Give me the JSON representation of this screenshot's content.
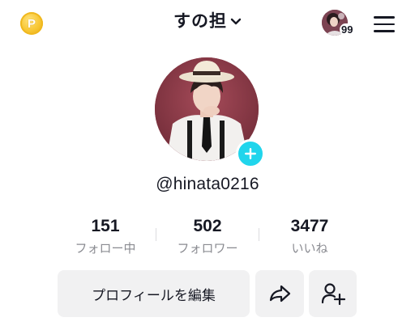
{
  "header": {
    "coin_symbol": "P",
    "title": "すの担",
    "notification_count": "99"
  },
  "profile": {
    "username": "@hinata0216"
  },
  "stats": [
    {
      "value": "151",
      "label": "フォロー中"
    },
    {
      "value": "502",
      "label": "フォロワー"
    },
    {
      "value": "3477",
      "label": "いいね"
    }
  ],
  "actions": {
    "edit_profile_label": "プロフィールを編集"
  },
  "colors": {
    "accent_add": "#20d5ec",
    "coin": "#f7c531",
    "button_bg": "#f1f1f2",
    "secondary_text": "#8a8b91"
  }
}
